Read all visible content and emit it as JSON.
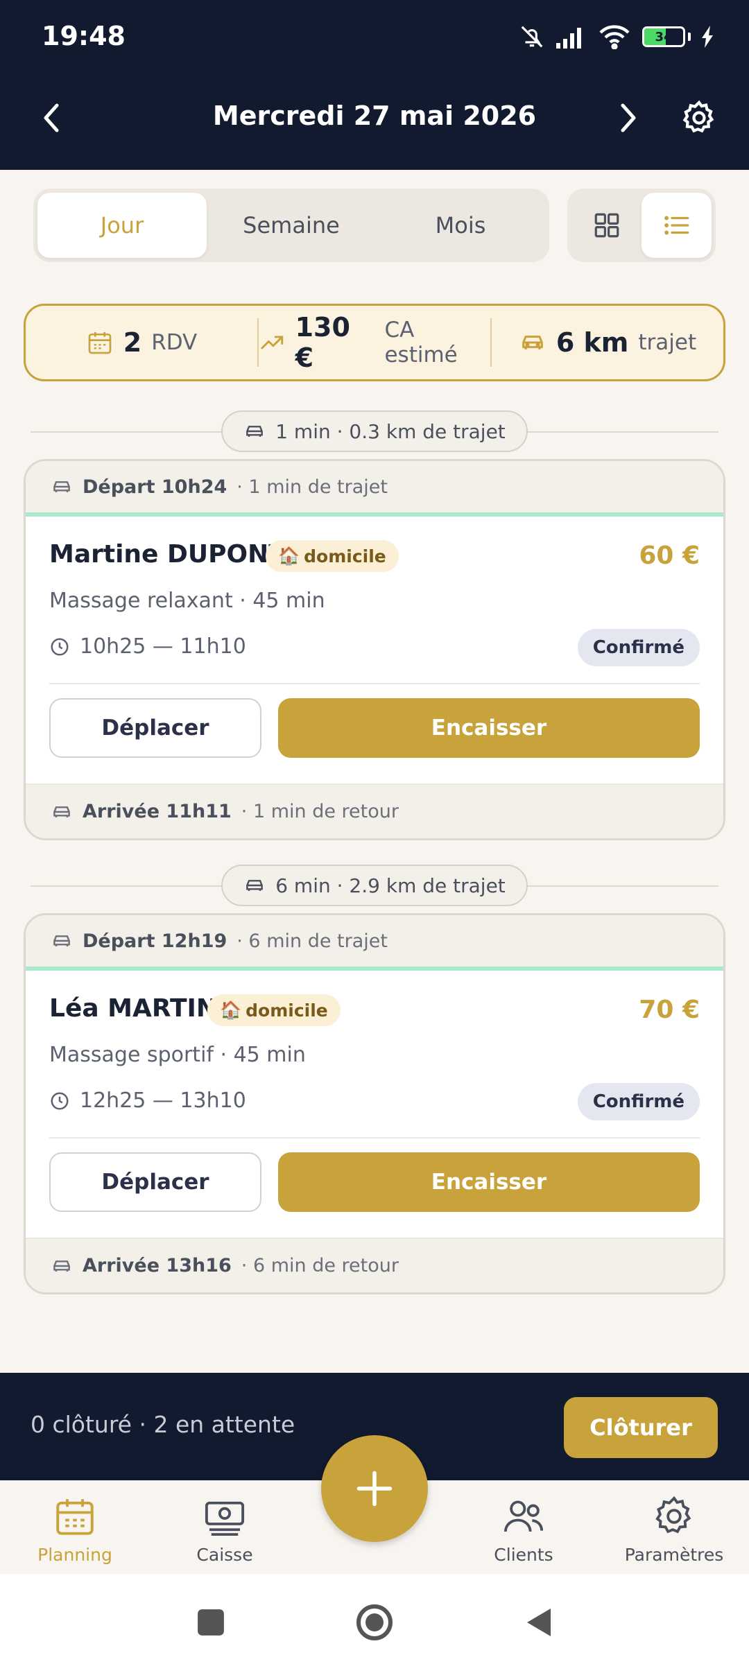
{
  "status_bar": {
    "time": "19:48",
    "battery": "34"
  },
  "header": {
    "title": "Mercredi 27 mai 2026"
  },
  "view_tabs": [
    "Jour",
    "Semaine",
    "Mois"
  ],
  "summary": {
    "rdv_value": "2",
    "rdv_label": "RDV",
    "ca_value": "130 €",
    "ca_label": "CA estimé",
    "km_value": "6 km",
    "km_label": "trajet"
  },
  "appointments": [
    {
      "travel": "1 min · 0.3 km de trajet",
      "departure": "Départ 10h24",
      "departure_detail": "· 1 min de trajet",
      "name": "Martine DUPONT",
      "badge": "domicile",
      "price": "60 €",
      "service": "Massage relaxant · 45 min",
      "time": "10h25 — 11h10",
      "status": "Confirmé",
      "move_label": "Déplacer",
      "pay_label": "Encaisser",
      "arrival": "Arrivée 11h11",
      "arrival_detail": "· 1 min de retour"
    },
    {
      "travel": "6 min · 2.9 km de trajet",
      "departure": "Départ 12h19",
      "departure_detail": "· 6 min de trajet",
      "name": "Léa MARTIN",
      "badge": "domicile",
      "price": "70 €",
      "service": "Massage sportif · 45 min",
      "time": "12h25 — 13h10",
      "status": "Confirmé",
      "move_label": "Déplacer",
      "pay_label": "Encaisser",
      "arrival": "Arrivée 13h16",
      "arrival_detail": "· 6 min de retour"
    }
  ],
  "close_bar": {
    "text": "0 clôturé · 2 en attente",
    "button": "Clôturer"
  },
  "tabs": [
    "Planning",
    "Caisse",
    "Clients",
    "Paramètres"
  ],
  "colors": {
    "accent": "#c8a23a",
    "dark": "#111a2e",
    "mint": "#a8e8cf"
  }
}
